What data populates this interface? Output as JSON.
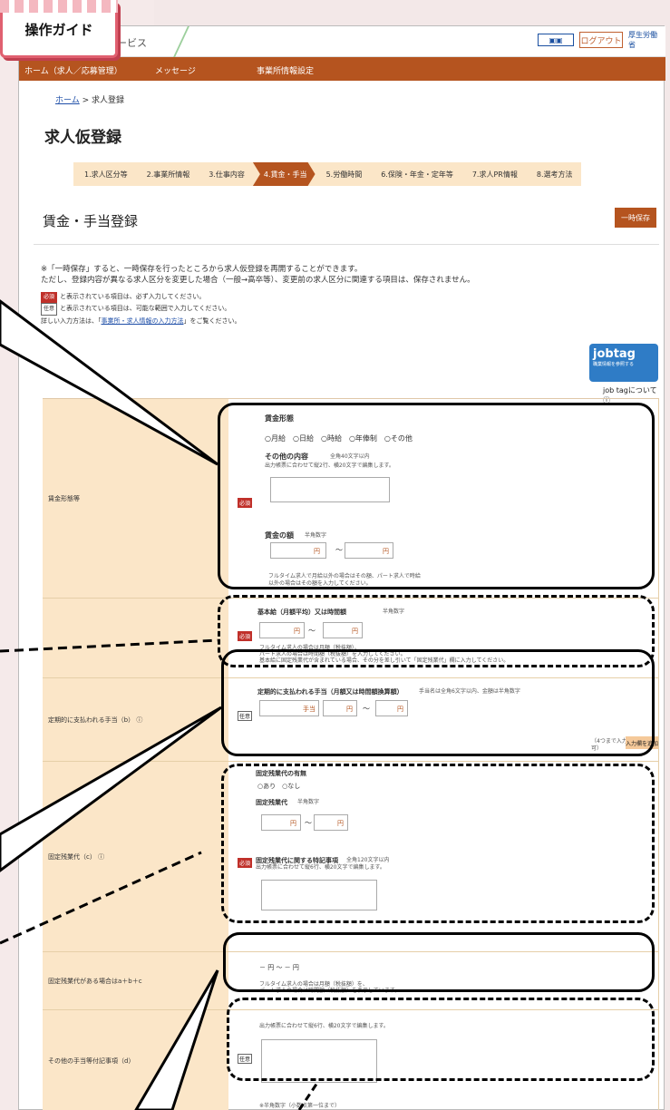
{
  "manual_badge": "操作ガイド",
  "header": {
    "site_name": "ービス",
    "logout": "ログアウト",
    "ministry": "厚生労働省"
  },
  "nav": {
    "items": [
      "ホーム（求人／応募管理）",
      "メッセージ",
      "事業所情報設定"
    ]
  },
  "breadcrumb": {
    "home": "ホーム",
    "current": " > 求人登録"
  },
  "page_title": "求人仮登録",
  "steps": [
    "1.求人区分等",
    "2.事業所情報",
    "3.仕事内容",
    "4.賃金・手当",
    "5.労働時間",
    "6.保険・年金・定年等",
    "7.求人PR情報",
    "8.選考方法"
  ],
  "active_step": 3,
  "section_title": "賃金・手当登録",
  "save_button": "一時保存",
  "notice": {
    "line1": "※「一時保存」すると、一時保存を行ったところから求人仮登録を再開することができます。",
    "line2": "ただし、登録内容が異なる求人区分を変更した場合（一般→高卒等）、変更前の求人区分に関連する項目は、保存されません。"
  },
  "legend": {
    "req_badge": "必須",
    "req_text": "と表示されている項目は、必ず入力してください。",
    "opt_badge": "任意",
    "opt_text": "と表示されている項目は、可能な範囲で入力してください。",
    "detail_pre": "詳しい入力方法は、「",
    "detail_link": "事業所・求人情報の入力方法",
    "detail_post": "」をご覧ください。"
  },
  "jobtag": {
    "name": "jobtag",
    "sub": "職業情報を参照する",
    "link": "job tagについて"
  },
  "rows": {
    "wage_type": {
      "label": "賃金形態等",
      "req": "必須",
      "heading": "賃金形態",
      "options": "○月給　○日給　○時給　○年俸制　○その他",
      "other_heading": "その他の内容",
      "other_hint": "全角40文字以内",
      "other_note": "出力帳票に合わせて縦2行、横20文字で編集します。",
      "amount_heading": "賃金の額",
      "amount_hint": "半角数字",
      "unit": "円",
      "tilde": "～",
      "note": "フルタイム求人で月給以外の場合はその額、パート求人で時給以外の場合はその額を入力してください。"
    },
    "base_pay": {
      "label": "",
      "req": "必須",
      "heading": "基本給（月額平均）又は時間額",
      "hint": "半角数字",
      "unit": "円",
      "tilde": "～",
      "note1": "フルタイム求人の場合は月額（税抜額）、",
      "note2": "パート求人の場合は時間額（税抜額）を入力してください。",
      "note3": "基本給に固定残業代が含まれている場合、その分を差し引いて「固定残業代」欄に入力してください。"
    },
    "allowance": {
      "label": "定期的に支払われる手当（b）",
      "opt": "任意",
      "heading": "定期的に支払われる手当（月額又は時間額換算額）",
      "hint": "手当名は全角6文字以内、金額は半角数字",
      "name_unit": "手当",
      "unit": "円",
      "tilde": "～",
      "count": "（4つまで入力可）",
      "add_button": "入力欄を追加"
    },
    "overtime": {
      "label": "固定残業代（c）",
      "req": "必須",
      "presence_heading": "固定残業代の有無",
      "presence_options": "○あり　○なし",
      "amount_heading": "固定残業代",
      "amount_hint": "半角数字",
      "unit": "円",
      "tilde": "～",
      "notes_heading": "固定残業代に関する特記事項",
      "notes_hint": "全角120文字以内",
      "notes_note": "出力帳票に合わせて縦6行、横20文字で編集します。"
    },
    "total": {
      "label": "固定残業代がある場合はa＋b＋c",
      "value": "－ 円 ～ － 円",
      "note1": "フルタイム求人の場合は月額（税抜額）を、",
      "note2": "パート求人の場合は時間額（税抜額）を表示しています。"
    },
    "other": {
      "label": "その他の手当等付記事項（d）",
      "opt": "任意",
      "note": "出力帳票に合わせて縦6行、横20文字で編集します。",
      "footer": "※半角数字（小数点第一位まで）"
    }
  }
}
